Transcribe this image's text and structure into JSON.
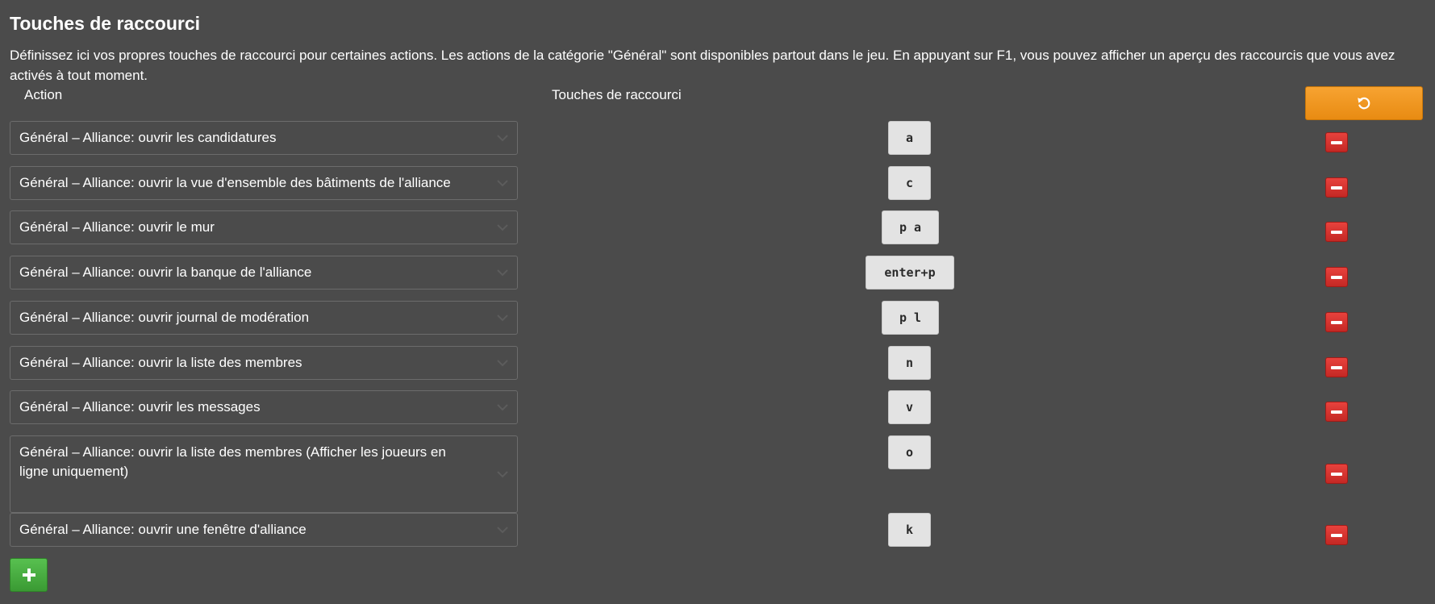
{
  "title": "Touches de raccourci",
  "description": "Définissez ici vos propres touches de raccourci pour certaines actions. Les actions de la catégorie \"Général\" sont disponibles partout dans le jeu. En appuyant sur F1, vous pouvez afficher un aperçu des raccourcis que vous avez activés à tout moment.",
  "columns": {
    "action": "Action",
    "keys": "Touches de raccourci"
  },
  "reset_icon": "undo-icon",
  "add_icon": "plus-icon",
  "remove_icon": "minus-icon",
  "colors": {
    "reset": "#f39a24",
    "remove": "#d7322e",
    "add": "#4aad42",
    "background": "#4b4b4b"
  },
  "rows": [
    {
      "action": "Général – Alliance: ouvrir les candidatures",
      "keys": "a"
    },
    {
      "action": "Général – Alliance: ouvrir la vue d'ensemble des bâtiments de l'alliance",
      "keys": "c"
    },
    {
      "action": "Général – Alliance: ouvrir le mur",
      "keys": "p a"
    },
    {
      "action": "Général – Alliance: ouvrir la banque de l'alliance",
      "keys": "enter+p"
    },
    {
      "action": "Général – Alliance: ouvrir journal de modération",
      "keys": "p l"
    },
    {
      "action": "Général – Alliance: ouvrir la liste des membres",
      "keys": "n"
    },
    {
      "action": "Général – Alliance: ouvrir les messages",
      "keys": "v"
    },
    {
      "action": "Général – Alliance: ouvrir la liste des membres (Afficher les joueurs en ligne uniquement)",
      "keys": "o"
    },
    {
      "action": "Général – Alliance: ouvrir une fenêtre d'alliance",
      "keys": "k"
    }
  ]
}
